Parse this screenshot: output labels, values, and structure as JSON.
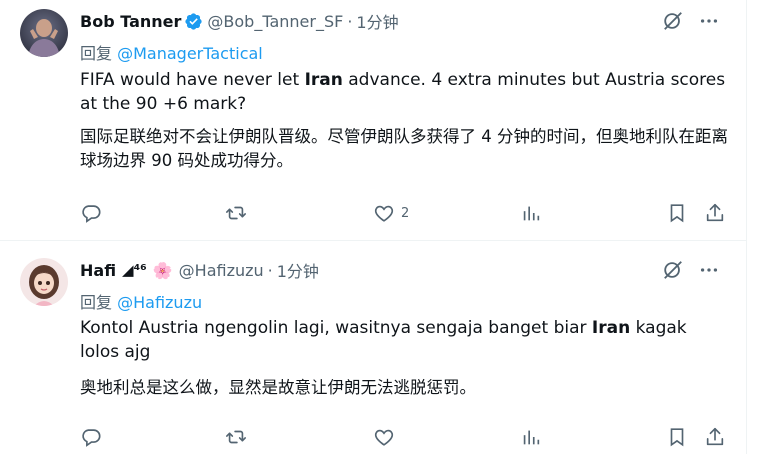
{
  "tweets": [
    {
      "name": "Bob Tanner",
      "handle": "@Bob_Tanner_SF",
      "dot": "·",
      "time": "1分钟",
      "reply_prefix": "回复",
      "reply_to": "@ManagerTactical",
      "text_a": "FIFA would have never let ",
      "text_bold": "Iran",
      "text_b": " advance. 4 extra minutes but Austria scores at the 90 +6 mark?",
      "translation": "国际足联绝对不会让伊朗队晋级。尽管伊朗队多获得了 4 分钟的时间，但奥地利队在距离球场边界 90 码处成功得分。",
      "like_count": "2",
      "verified": true,
      "icons": [
        "grok-icon",
        "more-icon",
        "reply-icon",
        "retweet-icon",
        "like-icon",
        "views-icon",
        "bookmark-icon",
        "share-icon"
      ]
    },
    {
      "name": "Hafi",
      "name_suffix": "◢⁴⁶",
      "handle": "@Hafizuzu",
      "dot": "·",
      "time": "1分钟",
      "reply_prefix": "回复",
      "reply_to": "@Hafizuzu",
      "text_a": "Kontol Austria ngengolin lagi, wasitnya sengaja banget biar ",
      "text_bold": "Iran",
      "text_b": " kagak lolos ajg",
      "translation": "奥地利总是这么做，显然是故意让伊朗无法逃脱惩罚。",
      "emoji": "🌸",
      "icons": [
        "grok-icon",
        "more-icon",
        "reply-icon",
        "retweet-icon",
        "like-icon",
        "views-icon",
        "bookmark-icon",
        "share-icon"
      ]
    }
  ],
  "colors": {
    "text": "#0f1419",
    "muted": "#536471",
    "link": "#1d9bf0",
    "verified": "#1d9bf0",
    "divider": "#eff3f4"
  }
}
